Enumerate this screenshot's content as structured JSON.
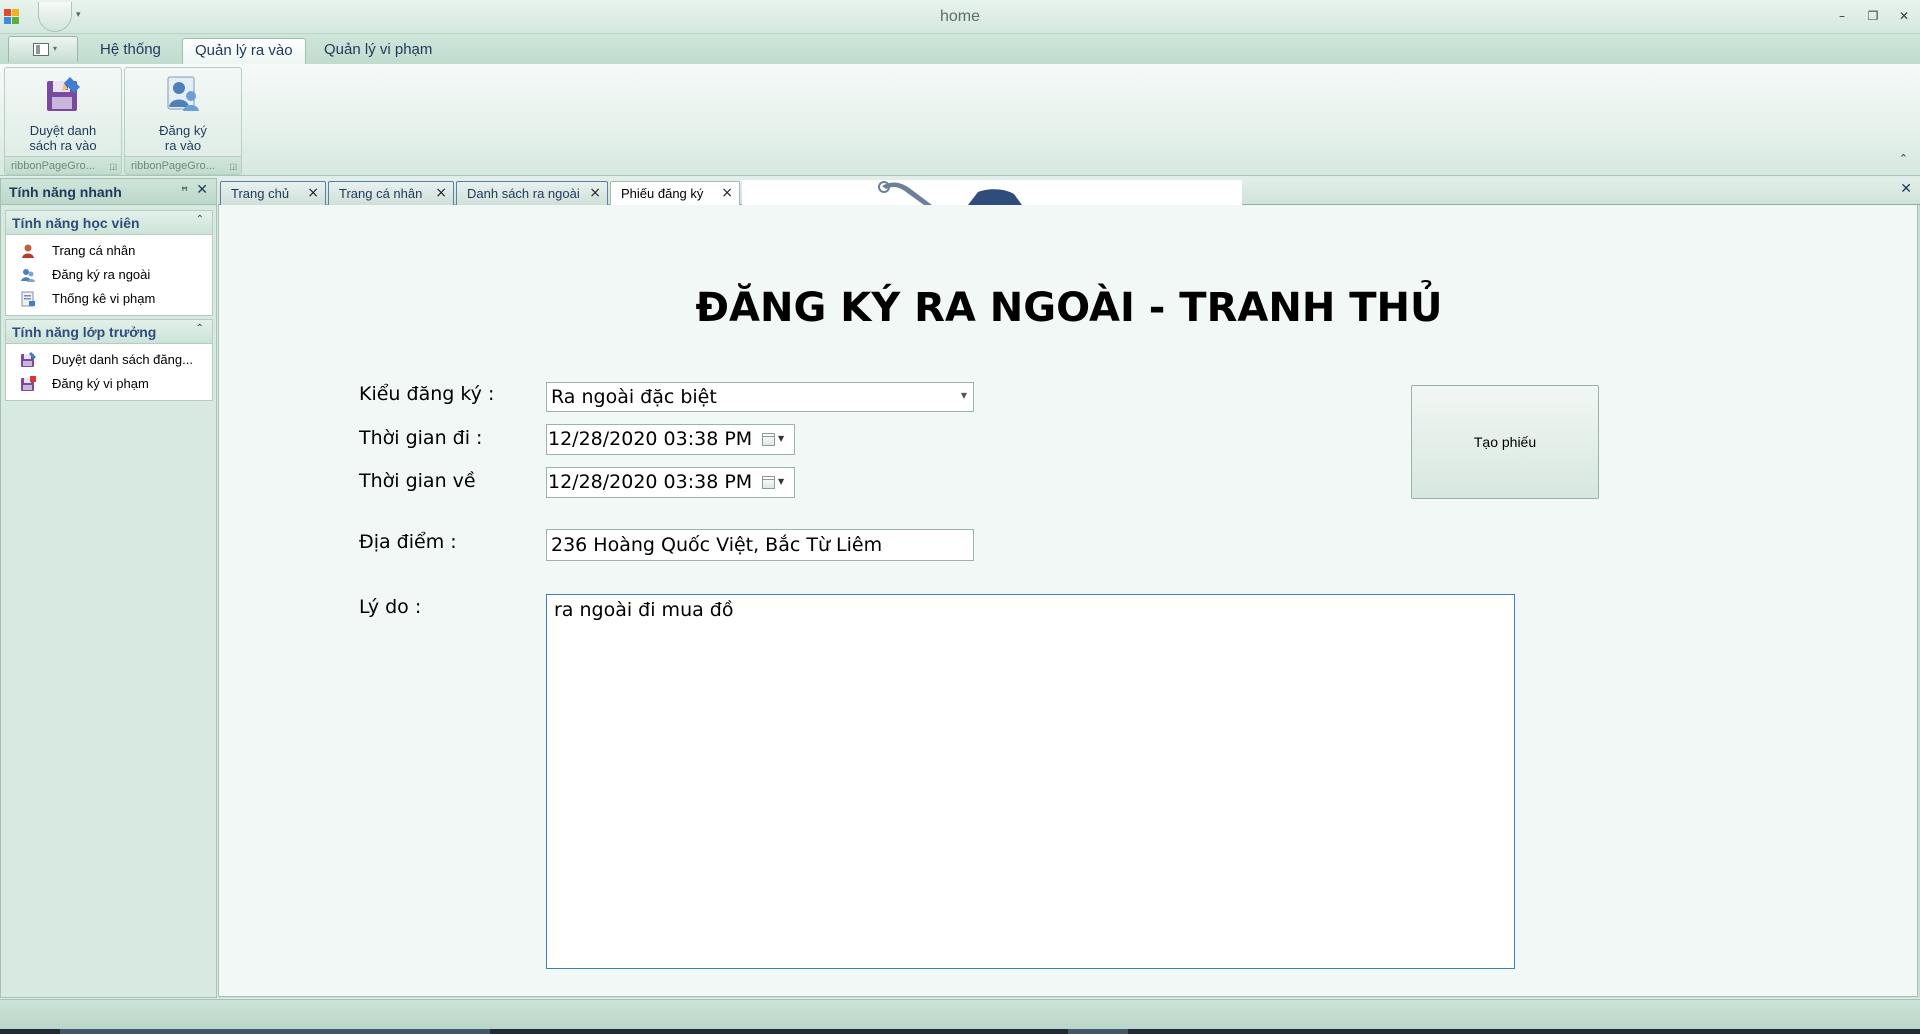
{
  "window": {
    "title": "home"
  },
  "ribbon": {
    "tabs": [
      {
        "label": "Hệ thống",
        "active": false
      },
      {
        "label": "Quản lý ra vào",
        "active": true
      },
      {
        "label": "Quản lý vi phạm",
        "active": false
      }
    ],
    "groups": [
      {
        "button_label_line1": "Duyệt danh",
        "button_label_line2": "sách ra vào",
        "caption": "ribbonPageGro...",
        "icon": "save-disk-edit-icon"
      },
      {
        "button_label_line1": "Đăng ký",
        "button_label_line2": "ra vào",
        "caption": "ribbonPageGro...",
        "icon": "users-register-icon"
      }
    ]
  },
  "nav": {
    "header": "Tính năng nhanh",
    "groups": [
      {
        "title": "Tính năng học viên",
        "items": [
          {
            "label": "Trang cá nhân",
            "icon": "user-profile-icon"
          },
          {
            "label": "Đăng ký ra ngoài",
            "icon": "users-icon"
          },
          {
            "label": "Thống kê vi phạm",
            "icon": "report-icon"
          }
        ]
      },
      {
        "title": "Tính năng lớp trưởng",
        "items": [
          {
            "label": "Duyệt danh sách đăng...",
            "icon": "save-edit-icon"
          },
          {
            "label": "Đăng ký vi phạm",
            "icon": "save-violation-icon"
          }
        ]
      }
    ]
  },
  "doc_tabs": [
    {
      "label": "Trang chủ",
      "active": false
    },
    {
      "label": "Trang cá nhân",
      "active": false
    },
    {
      "label": "Danh sách ra ngoài",
      "active": false
    },
    {
      "label": "Phiếu đăng ký",
      "active": true
    }
  ],
  "form": {
    "title": "ĐĂNG KÝ RA NGOÀI - TRANH THỦ",
    "type_label": "Kiểu đăng ký :",
    "type_value": "Ra ngoài đặc biệt",
    "depart_label": "Thời gian đi :",
    "depart_value": "12/28/2020 03:38 PM",
    "return_label": "Thời gian về",
    "return_value": "12/28/2020 03:38 PM",
    "place_label": "Địa điểm :",
    "place_value": "236 Hoàng Quốc Việt, Bắc Từ Liêm",
    "reason_label": "Lý do :",
    "reason_value": "ra ngoài đi mua đồ",
    "create_button": "Tạo phiếu"
  },
  "colors": {
    "accent_border": "#3c7fc1",
    "ribbon_bg": "#d6e8df",
    "tab_border": "#5c7ea8"
  }
}
